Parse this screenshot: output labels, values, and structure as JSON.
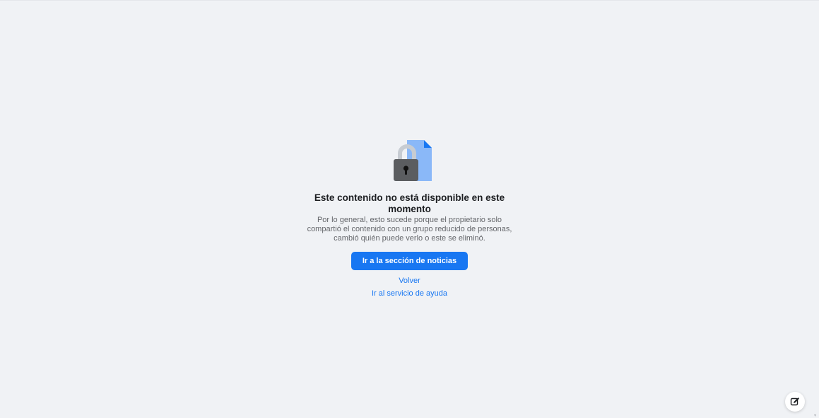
{
  "message": {
    "title": "Este contenido no está disponible en este momento",
    "description": "Por lo general, esto sucede porque el propietario solo compartió el contenido con un grupo reducido de personas, cambió quién puede verlo o este se eliminó.",
    "primary_button_label": "Ir a la sección de noticias",
    "back_link_label": "Volver",
    "help_link_label": "Ir al servicio de ayuda"
  },
  "icons": {
    "illustration": "locked-document-icon",
    "floating_action": "new-message-icon"
  },
  "colors": {
    "background": "#f0f2f5",
    "accent": "#1877f2",
    "document": "#8ab8f8",
    "document_fold": "#1877f2",
    "lock_body": "#5b5d60",
    "lock_shackle": "#c7ccd2"
  }
}
